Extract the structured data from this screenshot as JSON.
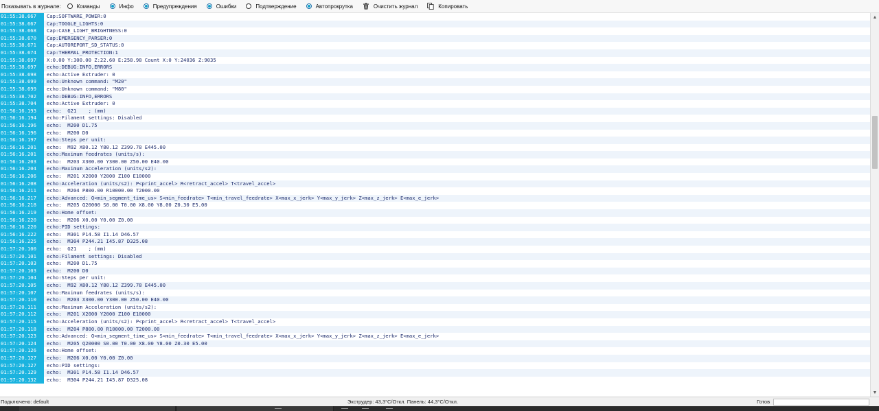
{
  "toolbar": {
    "show_label": "Показывать в журнале:",
    "filters": [
      {
        "label": "Команды",
        "checked": false
      },
      {
        "label": "Инфо",
        "checked": true
      },
      {
        "label": "Предупреждения",
        "checked": true
      },
      {
        "label": "Ошибки",
        "checked": true
      },
      {
        "label": "Подтверждение",
        "checked": false
      },
      {
        "label": "Автопрокрутка",
        "checked": true
      }
    ],
    "clear_label": "Очистить журнал",
    "copy_label": "Копировать",
    "clear_icon": "trash-icon",
    "copy_icon": "copy-icon"
  },
  "colors": {
    "timestamp_bg": "#1ab3df",
    "message_text": "#1b2a6b",
    "row_alt_bg": "#eef4fb"
  },
  "log": [
    {
      "time": "01:55:38.667",
      "msg": "Cap:SOFTWARE_POWER:0"
    },
    {
      "time": "01:55:38.667",
      "msg": "Cap:TOGGLE_LIGHTS:0"
    },
    {
      "time": "01:55:38.668",
      "msg": "Cap:CASE_LIGHT_BRIGHTNESS:0"
    },
    {
      "time": "01:55:38.670",
      "msg": "Cap:EMERGENCY_PARSER:0"
    },
    {
      "time": "01:55:38.671",
      "msg": "Cap:AUTOREPORT_SD_STATUS:0"
    },
    {
      "time": "01:55:38.674",
      "msg": "Cap:THERMAL_PROTECTION:1"
    },
    {
      "time": "01:55:38.697",
      "msg": "X:0.00 Y:300.00 Z:22.60 E:258.98 Count X:0 Y:24036 Z:9035"
    },
    {
      "time": "01:55:38.697",
      "msg": "echo:DEBUG:INFO,ERRORS"
    },
    {
      "time": "01:55:38.698",
      "msg": "echo:Active Extruder: 0"
    },
    {
      "time": "01:55:38.699",
      "msg": "echo:Unknown command: \"M20\""
    },
    {
      "time": "01:55:38.699",
      "msg": "echo:Unknown command: \"M80\""
    },
    {
      "time": "01:55:38.702",
      "msg": "echo:DEBUG:INFO,ERRORS"
    },
    {
      "time": "01:55:38.704",
      "msg": "echo:Active Extruder: 0"
    },
    {
      "time": "01:56:16.193",
      "msg": "echo:  G21    ; (mm)"
    },
    {
      "time": "01:56:16.194",
      "msg": "echo:Filament settings: Disabled"
    },
    {
      "time": "01:56:16.196",
      "msg": "echo:  M200 D1.75"
    },
    {
      "time": "01:56:16.196",
      "msg": "echo:  M200 D0"
    },
    {
      "time": "01:56:16.197",
      "msg": "echo:Steps per unit:"
    },
    {
      "time": "01:56:16.201",
      "msg": "echo:  M92 X80.12 Y80.12 Z399.78 E445.00"
    },
    {
      "time": "01:56:16.201",
      "msg": "echo:Maximum feedrates (units/s):"
    },
    {
      "time": "01:56:16.203",
      "msg": "echo:  M203 X300.00 Y300.00 Z50.00 E40.00"
    },
    {
      "time": "01:56:16.204",
      "msg": "echo:Maximum Acceleration (units/s2):"
    },
    {
      "time": "01:56:16.206",
      "msg": "echo:  M201 X2000 Y2000 Z100 E10000"
    },
    {
      "time": "01:56:16.208",
      "msg": "echo:Acceleration (units/s2): P<print_accel> R<retract_accel> T<travel_accel>"
    },
    {
      "time": "01:56:16.211",
      "msg": "echo:  M204 P800.00 R10000.00 T2000.00"
    },
    {
      "time": "01:56:16.217",
      "msg": "echo:Advanced: Q<min_segment_time_us> S<min_feedrate> T<min_travel_feedrate> X<max_x_jerk> Y<max_y_jerk> Z<max_z_jerk> E<max_e_jerk>"
    },
    {
      "time": "01:56:16.218",
      "msg": "echo:  M205 Q20000 S0.00 T0.00 X8.00 Y8.00 Z0.30 E5.00"
    },
    {
      "time": "01:56:16.219",
      "msg": "echo:Home offset:"
    },
    {
      "time": "01:56:16.220",
      "msg": "echo:  M206 X0.00 Y0.00 Z0.00"
    },
    {
      "time": "01:56:16.220",
      "msg": "echo:PID settings:"
    },
    {
      "time": "01:56:16.222",
      "msg": "echo:  M301 P14.58 I1.14 D46.57"
    },
    {
      "time": "01:56:16.225",
      "msg": "echo:  M304 P244.21 I45.87 D325.08"
    },
    {
      "time": "01:57:20.100",
      "msg": "echo:  G21    ; (mm)"
    },
    {
      "time": "01:57:20.101",
      "msg": "echo:Filament settings: Disabled"
    },
    {
      "time": "01:57:20.103",
      "msg": "echo:  M200 D1.75"
    },
    {
      "time": "01:57:20.103",
      "msg": "echo:  M200 D0"
    },
    {
      "time": "01:57:20.104",
      "msg": "echo:Steps per unit:"
    },
    {
      "time": "01:57:20.105",
      "msg": "echo:  M92 X80.12 Y80.12 Z399.78 E445.00"
    },
    {
      "time": "01:57:20.107",
      "msg": "echo:Maximum feedrates (units/s):"
    },
    {
      "time": "01:57:20.110",
      "msg": "echo:  M203 X300.00 Y300.00 Z50.00 E40.00"
    },
    {
      "time": "01:57:20.111",
      "msg": "echo:Maximum Acceleration (units/s2):"
    },
    {
      "time": "01:57:20.112",
      "msg": "echo:  M201 X2000 Y2000 Z100 E10000"
    },
    {
      "time": "01:57:20.115",
      "msg": "echo:Acceleration (units/s2): P<print_accel> R<retract_accel> T<travel_accel>"
    },
    {
      "time": "01:57:20.118",
      "msg": "echo:  M204 P800.00 R10000.00 T2000.00"
    },
    {
      "time": "01:57:20.123",
      "msg": "echo:Advanced: Q<min_segment_time_us> S<min_feedrate> T<min_travel_feedrate> X<max_x_jerk> Y<max_y_jerk> Z<max_z_jerk> E<max_e_jerk>"
    },
    {
      "time": "01:57:20.124",
      "msg": "echo:  M205 Q20000 S0.00 T0.00 X8.00 Y8.00 Z0.30 E5.00"
    },
    {
      "time": "01:57:20.126",
      "msg": "echo:Home offset:"
    },
    {
      "time": "01:57:20.127",
      "msg": "echo:  M206 X0.00 Y0.00 Z0.00"
    },
    {
      "time": "01:57:20.127",
      "msg": "echo:PID settings:"
    },
    {
      "time": "01:57:20.129",
      "msg": "echo:  M301 P14.58 I1.14 D46.57"
    },
    {
      "time": "01:57:20.132",
      "msg": "echo:  M304 P244.21 I45.87 D325.08"
    }
  ],
  "status": {
    "connection": "Подключено: default",
    "temperature": "Экструдер: 43,3°C/Откл. Панель: 44,3°C/Откл.",
    "ready": "Готов",
    "progress": 0
  }
}
